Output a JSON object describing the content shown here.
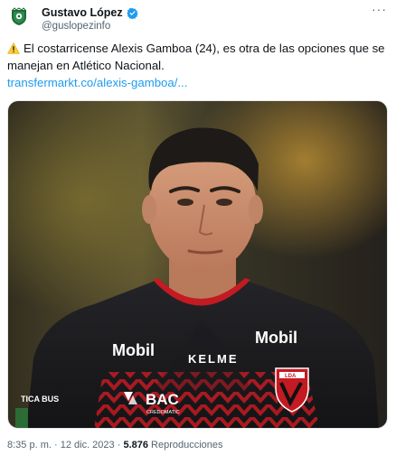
{
  "author": {
    "name": "Gustavo López",
    "handle": "@guslopezinfo",
    "verified": true
  },
  "tweet": {
    "text": "El costarricense Alexis Gamboa (24), es otra de las opciones que se manejan en Atlético Nacional.",
    "link": "transfermarkt.co/alexis-gamboa/..."
  },
  "media": {
    "jersey_sponsor": "Mobil",
    "jersey_brand": "KELME",
    "jersey_sponsor_2": "BAC",
    "jersey_sponsor_2_sub": "CREDOMATIC",
    "sleeve_text": "TICA BUS",
    "crest_text": "LDA"
  },
  "meta": {
    "time": "8:35 p. m.",
    "separator": "·",
    "date": "12 dic. 2023",
    "views": "5.876",
    "views_label": "Reproducciones"
  },
  "colors": {
    "link": "#1d9bf0",
    "verified": "#1d9bf0",
    "secondary": "#536471",
    "jersey_red": "#c41a22"
  }
}
